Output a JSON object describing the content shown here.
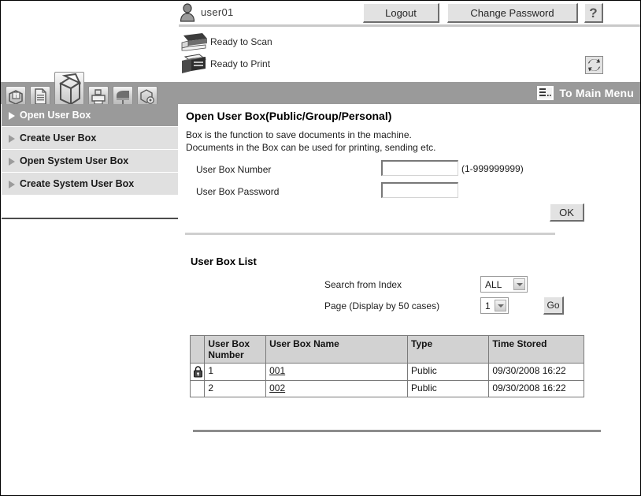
{
  "header": {
    "user_icon": "user-icon",
    "user_name": "user01",
    "logout_label": "Logout",
    "change_password_label": "Change Password",
    "help_label": "?",
    "refresh_icon": "refresh-icon",
    "status": [
      {
        "icon": "scanner-icon",
        "text": "Ready to Scan"
      },
      {
        "icon": "printer-icon",
        "text": "Ready to Print"
      }
    ]
  },
  "tabs": [
    {
      "name": "tab-information",
      "icon": "info-box-icon",
      "active": false
    },
    {
      "name": "tab-document",
      "icon": "document-icon",
      "active": false
    },
    {
      "name": "tab-box",
      "icon": "open-box-icon",
      "active": true
    },
    {
      "name": "tab-print",
      "icon": "printer-tray-icon",
      "active": false
    },
    {
      "name": "tab-scan",
      "icon": "mailbox-icon",
      "active": false
    },
    {
      "name": "tab-settings",
      "icon": "box-gear-icon",
      "active": false
    }
  ],
  "to_main_menu": {
    "icon": "main-menu-icon",
    "label": "To Main Menu"
  },
  "sidebar": {
    "items": [
      {
        "label": "Open User Box",
        "active": true
      },
      {
        "label": "Create User Box",
        "active": false
      },
      {
        "label": "Open System User Box",
        "active": false
      },
      {
        "label": "Create System User Box",
        "active": false
      }
    ]
  },
  "main": {
    "title": "Open User Box(Public/Group/Personal)",
    "description_line1": "Box is the function to save documents in the machine.",
    "description_line2": "Documents in the Box can be used for printing, sending etc.",
    "fields": {
      "userbox_number_label": "User Box Number",
      "userbox_number_value": "",
      "userbox_number_hint": "(1-999999999)",
      "userbox_password_label": "User Box Password",
      "userbox_password_value": ""
    },
    "ok_label": "OK"
  },
  "list": {
    "title": "User Box List",
    "search_from_index_label": "Search from Index",
    "search_from_index_value": "ALL",
    "search_from_index_options": [
      "ALL"
    ],
    "page_label": "Page (Display by 50 cases)",
    "page_value": "1",
    "page_options": [
      "1"
    ],
    "go_label": "Go",
    "columns": [
      "",
      "User Box\nNumber",
      "User Box Name",
      "Type",
      "Time Stored"
    ],
    "column_lock": "",
    "column_number_line1": "User Box",
    "column_number_line2": "Number",
    "column_name": "User Box Name",
    "column_type": "Type",
    "column_time": "Time Stored",
    "rows": [
      {
        "locked": true,
        "lock_icon": "lock-icon",
        "number": "1",
        "name": "001",
        "type": "Public",
        "time_stored": "09/30/2008 16:22"
      },
      {
        "locked": false,
        "lock_icon": "",
        "number": "2",
        "name": "002",
        "type": "Public",
        "time_stored": "09/30/2008 16:22"
      }
    ]
  },
  "colors": {
    "tab_strip": "#9a9a9a",
    "sidebar_active": "#9a9a9a",
    "sidebar_item": "#e0e0e0",
    "table_header": "#d2d2d2",
    "button_face": "#e2e2e2"
  }
}
